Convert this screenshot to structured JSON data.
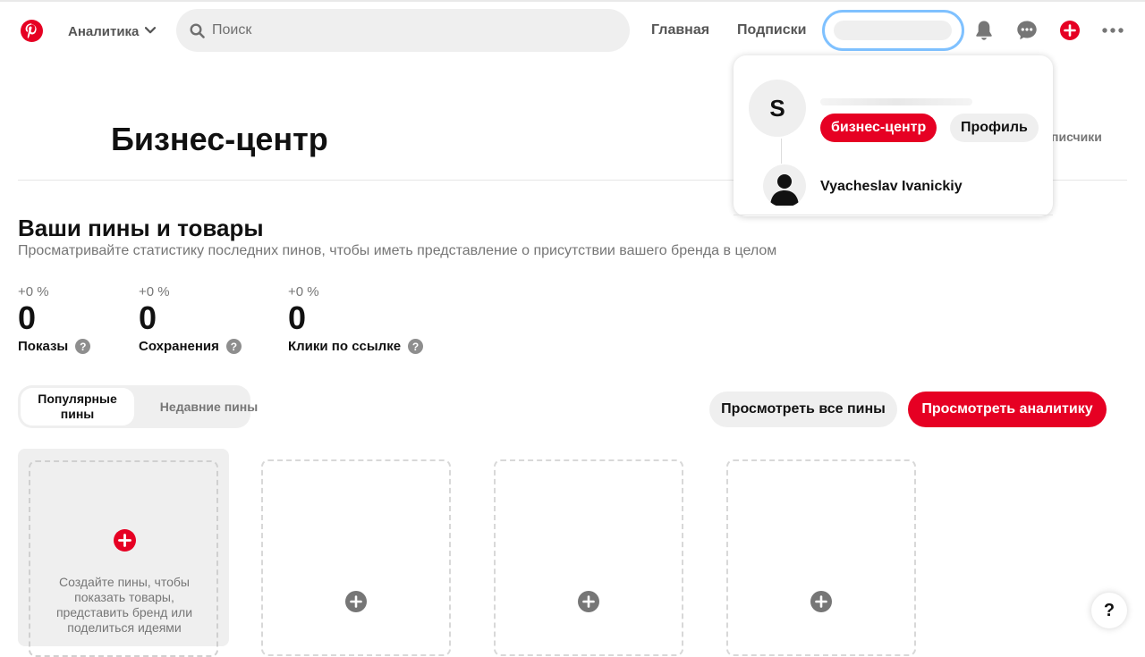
{
  "header": {
    "analytics_label": "Аналитика",
    "search_placeholder": "Поиск",
    "nav_home": "Главная",
    "nav_subscriptions": "Подписки"
  },
  "dropdown": {
    "avatar_letter": "S",
    "business_center": "бизнес-центр",
    "profile": "Профиль",
    "user_name": "Vyacheslav Ivanickiy"
  },
  "peek_tab_label": "писчики",
  "page": {
    "title": "Бизнес-центр",
    "section_title": "Ваши пины и товары",
    "section_subtitle": "Просматривайте статистику последних пинов, чтобы иметь представление о присутствии вашего бренда в целом"
  },
  "stats": [
    {
      "pct": "+0 %",
      "value": "0",
      "label": "Показы"
    },
    {
      "pct": "+0 %",
      "value": "0",
      "label": "Сохранения"
    },
    {
      "pct": "+0 %",
      "value": "0",
      "label": "Клики по ссылке"
    }
  ],
  "tabs": {
    "popular": "Популярные пины",
    "recent": "Недавние пины"
  },
  "buttons": {
    "view_all_pins": "Просмотреть все пины",
    "view_analytics": "Просмотреть аналитику"
  },
  "empty_card_text": "Создайте пины, чтобы показать товары, представить бренд или поделиться идеями",
  "help_label": "?",
  "colors": {
    "brand": "#e60023",
    "focus_ring": "#7fc1ff",
    "muted": "#767676",
    "surface": "#efefef"
  }
}
